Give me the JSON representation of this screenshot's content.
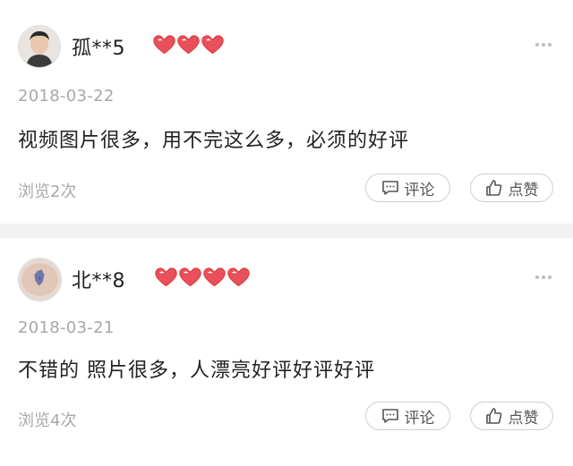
{
  "reviews": [
    {
      "username": "孤**5",
      "rank_hearts": 3,
      "date": "2018-03-22",
      "content": "视频图片很多，用不完这么多，必须的好评",
      "views": "浏览2次",
      "comment_label": "评论",
      "like_label": "点赞"
    },
    {
      "username": "北**8",
      "rank_hearts": 4,
      "date": "2018-03-21",
      "content": "不错的 照片很多，人漂亮好评好评好评",
      "views": "浏览4次",
      "comment_label": "评论",
      "like_label": "点赞"
    }
  ],
  "colors": {
    "heart": "#e8505b",
    "muted_text": "#a8a8a8",
    "divider": "#f2f2f2"
  },
  "icons": {
    "rank": "heart-icon",
    "comment": "comment-icon",
    "like": "thumbs-up-icon",
    "more": "more-dots-icon"
  }
}
